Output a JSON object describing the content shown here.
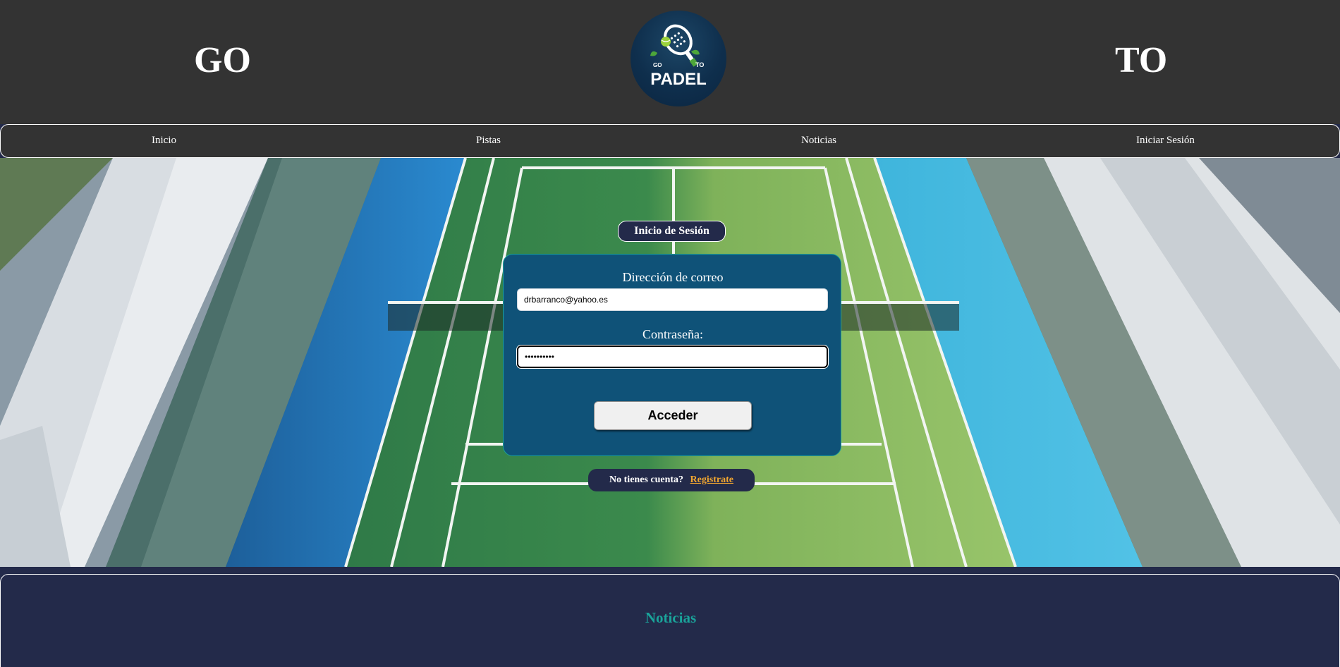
{
  "header": {
    "left_word": "GO",
    "right_word": "TO",
    "logo_text": "PADEL",
    "logo_small_text": "TO",
    "logo_side_text": "GO",
    "logo_icon": "padel-racket-logo-icon"
  },
  "nav": {
    "items": [
      "Inicio",
      "Pistas",
      "Noticias",
      "Iniciar Sesión"
    ]
  },
  "login": {
    "title": "Inicio de Sesión",
    "email_label": "Dirección de correo",
    "email_value": "drbarranco@yahoo.es",
    "password_label": "Contraseña:",
    "password_value": "••••••••••",
    "submit_label": "Acceder"
  },
  "register": {
    "prompt": "No tienes cuenta?",
    "link": "Registrate"
  },
  "news": {
    "title": "Noticias"
  },
  "colors": {
    "header_bg": "#333333",
    "page_bg": "#232a4a",
    "login_box_bg": "#0f5278",
    "accent_teal": "#1aa39a",
    "link_orange": "#f1a630"
  }
}
